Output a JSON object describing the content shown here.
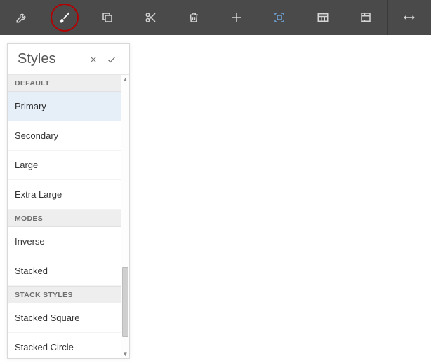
{
  "toolbar": {
    "items": [
      {
        "icon": "wrench-icon"
      },
      {
        "icon": "brush-icon",
        "highlighted": true
      },
      {
        "icon": "clone-icon"
      },
      {
        "icon": "cut-icon"
      },
      {
        "icon": "trash-icon"
      },
      {
        "icon": "plus-icon"
      },
      {
        "icon": "select-icon"
      },
      {
        "icon": "table-icon"
      },
      {
        "icon": "layout-icon"
      },
      {
        "icon": "resize-icon",
        "after_divider": true
      }
    ]
  },
  "panel": {
    "title": "Styles",
    "groups": [
      {
        "label": "DEFAULT",
        "items": [
          {
            "label": "Primary",
            "selected": true
          },
          {
            "label": "Secondary"
          },
          {
            "label": "Large"
          },
          {
            "label": "Extra Large"
          }
        ]
      },
      {
        "label": "MODES",
        "items": [
          {
            "label": "Inverse"
          },
          {
            "label": "Stacked"
          }
        ]
      },
      {
        "label": "STACK STYLES",
        "items": [
          {
            "label": "Stacked Square"
          },
          {
            "label": "Stacked Circle"
          }
        ]
      }
    ]
  }
}
